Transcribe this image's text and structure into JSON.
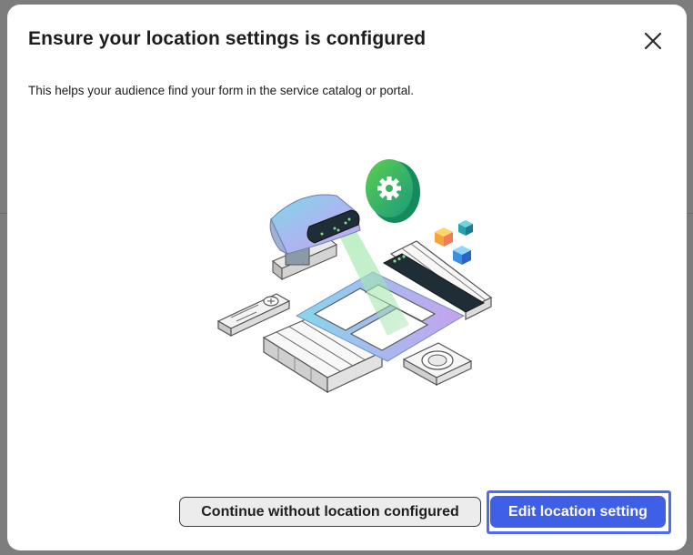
{
  "dialog": {
    "title": "Ensure your location settings is configured",
    "description": "This helps your audience find your form in the service catalog or portal.",
    "close_icon": "close-icon",
    "illustration_icons": [
      "robot-scanner-illustration",
      "gear-icon",
      "cube-icon"
    ]
  },
  "actions": {
    "secondary_label": "Continue without location configured",
    "primary_label": "Edit location setting"
  },
  "colors": {
    "primary": "#3f5fe6",
    "focus_ring": "#4f6bf0",
    "secondary_bg": "#ececec",
    "gear_green": "#2fa35a"
  }
}
